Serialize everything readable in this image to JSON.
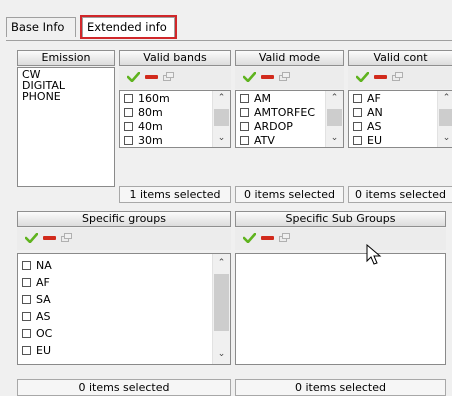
{
  "tabs": [
    {
      "label": "Base Info",
      "active": false
    },
    {
      "label": "Extended info",
      "active": true
    }
  ],
  "emission": {
    "header": "Emission",
    "items": [
      "CW",
      "DIGITAL",
      "PHONE"
    ]
  },
  "valid_bands": {
    "header": "Valid bands",
    "items": [
      "160m",
      "80m",
      "40m",
      "30m"
    ],
    "status": "1 items selected"
  },
  "valid_mode": {
    "header": "Valid mode",
    "items": [
      "AM",
      "AMTORFEC",
      "ARDOP",
      "ATV"
    ],
    "status": "0 items selected"
  },
  "valid_cont": {
    "header": "Valid cont",
    "items": [
      "AF",
      "AN",
      "AS",
      "EU"
    ],
    "status": "0 items selected"
  },
  "specific_groups": {
    "header": "Specific groups",
    "items": [
      "NA",
      "AF",
      "SA",
      "AS",
      "OC",
      "EU"
    ],
    "status": "0 items selected"
  },
  "specific_sub_groups": {
    "header": "Specific Sub Groups",
    "items": [],
    "status": "0 items selected"
  },
  "icons": {
    "select_all": "green-check-icon",
    "clear": "red-minus-icon",
    "window": "window-icon"
  },
  "colors": {
    "highlight": "#d0272a",
    "check_green": "#5fb31f",
    "minus_red": "#d12a1c"
  }
}
